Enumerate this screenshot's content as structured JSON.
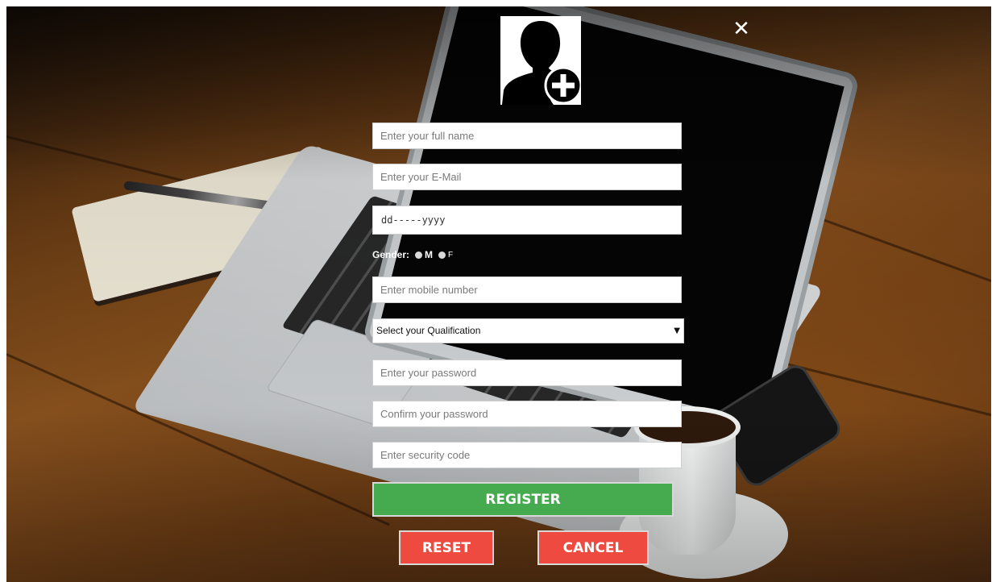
{
  "form": {
    "full_name_placeholder": "Enter your full name",
    "email_placeholder": "Enter your E-Mail",
    "dob_value": "dd-----yyyy",
    "gender_label": "Gender:",
    "gender_options": [
      "M",
      "F"
    ],
    "mobile_placeholder": "Enter mobile number",
    "qualification_selected": "Select your Qualification",
    "password_placeholder": "Enter your password",
    "confirm_password_placeholder": "Confirm your password",
    "security_code_placeholder": "Enter security code"
  },
  "buttons": {
    "register": "REGISTER",
    "reset": "RESET",
    "cancel": "CANCEL",
    "close": "✕"
  },
  "icons": {
    "avatar": "user-add-icon",
    "close": "close-icon",
    "dropdown": "caret-down-icon"
  },
  "colors": {
    "register": "#46ab4e",
    "reset": "#ee4a40",
    "cancel": "#ee4a40"
  }
}
